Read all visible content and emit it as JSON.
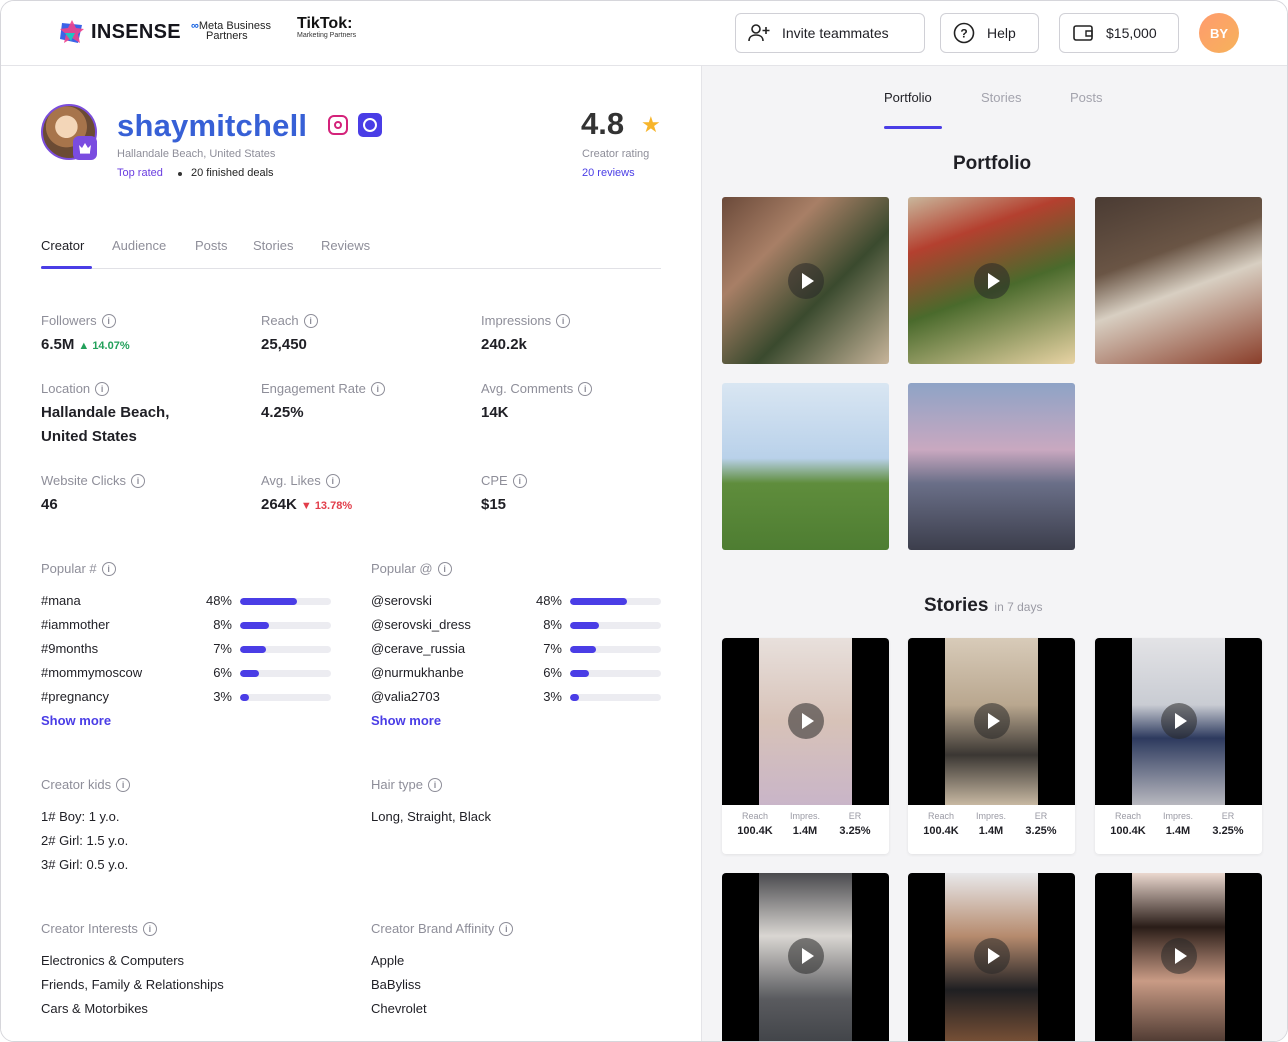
{
  "header": {
    "logo_text": "INSENSE",
    "meta_line1": "Meta Business",
    "meta_line2": "Partners",
    "tiktok_line1": "TikTok",
    "tiktok_line2": "Marketing Partners",
    "invite_label": "Invite teammates",
    "help_label": "Help",
    "balance_label": "$15,000",
    "user_initials": "BY"
  },
  "profile": {
    "username": "shaymitchell",
    "location": "Hallandale Beach, United States",
    "top_rated": "Top rated",
    "deals": "20 finished deals",
    "rating": "4.8",
    "rating_label": "Creator rating",
    "reviews": "20 reviews"
  },
  "tabs": [
    "Creator",
    "Audience",
    "Posts",
    "Stories",
    "Reviews"
  ],
  "stats": {
    "followers_label": "Followers",
    "followers_value": "6.5M",
    "followers_change": "14.07%",
    "reach_label": "Reach",
    "reach_value": "25,450",
    "impressions_label": "Impressions",
    "impressions_value": "240.2k",
    "location_label": "Location",
    "location_value_1": "Hallandale Beach,",
    "location_value_2": "United States",
    "er_label": "Engagement Rate",
    "er_value": "4.25%",
    "comments_label": "Avg. Comments",
    "comments_value": "14K",
    "clicks_label": "Website Clicks",
    "clicks_value": "46",
    "likes_label": "Avg. Likes",
    "likes_value": "264K",
    "likes_change": "13.78%",
    "cpe_label": "CPE",
    "cpe_value": "$15"
  },
  "popular_hashtags": {
    "label": "Popular #",
    "items": [
      {
        "name": "#mana",
        "pct": "48%",
        "fraction": 0.63
      },
      {
        "name": "#iammother",
        "pct": "8%",
        "fraction": 0.32
      },
      {
        "name": "#9months",
        "pct": "7%",
        "fraction": 0.29
      },
      {
        "name": "#mommymoscow",
        "pct": "6%",
        "fraction": 0.21
      },
      {
        "name": "#pregnancy",
        "pct": "3%",
        "fraction": 0.1
      }
    ],
    "show_more": "Show more"
  },
  "popular_mentions": {
    "label": "Popular @",
    "items": [
      {
        "name": "@serovski",
        "pct": "48%",
        "fraction": 0.63
      },
      {
        "name": "@serovski_dress",
        "pct": "8%",
        "fraction": 0.32
      },
      {
        "name": "@cerave_russia",
        "pct": "7%",
        "fraction": 0.29
      },
      {
        "name": "@nurmukhanbe",
        "pct": "6%",
        "fraction": 0.21
      },
      {
        "name": "@valia2703",
        "pct": "3%",
        "fraction": 0.1
      }
    ],
    "show_more": "Show more"
  },
  "kids": {
    "label": "Creator kids",
    "items": [
      "1# Boy: 1 y.o.",
      "2# Girl: 1.5 y.o.",
      "3# Girl: 0.5 y.o."
    ]
  },
  "hair": {
    "label": "Hair type",
    "value": "Long, Straight, Black"
  },
  "interests": {
    "label": "Creator Interests",
    "items": [
      "Electronics & Computers",
      "Friends, Family & Relationships",
      "Cars & Motorbikes"
    ]
  },
  "brands": {
    "label": "Creator Brand Affinity",
    "items": [
      "Apple",
      "BaByliss",
      "Chevrolet"
    ]
  },
  "right": {
    "tabs": [
      "Portfolio",
      "Stories",
      "Posts"
    ],
    "portfolio_title": "Portfolio",
    "stories_title": "Stories",
    "stories_sub": "in 7 days",
    "story_stats": [
      {
        "reach_label": "Reach",
        "reach": "100.4K",
        "impr_label": "Impres.",
        "impr": "1.4M",
        "er_label": "ER",
        "er": "3.25%"
      },
      {
        "reach_label": "Reach",
        "reach": "100.4K",
        "impr_label": "Impres.",
        "impr": "1.4M",
        "er_label": "ER",
        "er": "3.25%"
      },
      {
        "reach_label": "Reach",
        "reach": "100.4K",
        "impr_label": "Impres.",
        "impr": "1.4M",
        "er_label": "ER",
        "er": "3.25%"
      }
    ]
  },
  "colors": {
    "accent": "#4a3de6",
    "username": "#3760d6",
    "positive": "#22a05a",
    "negative": "#e23d4a"
  }
}
